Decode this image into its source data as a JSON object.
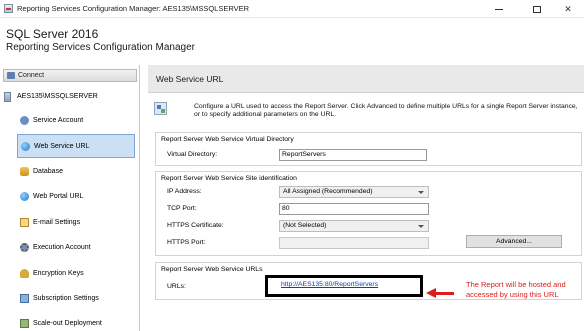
{
  "window": {
    "title": "Reporting Services Configuration Manager: AES135\\MSSQLSERVER"
  },
  "header": {
    "product": "SQL Server 2016",
    "subtitle": "Reporting Services Configuration Manager"
  },
  "sidebar": {
    "connect_label": "Connect",
    "server": "AES135\\MSSQLSERVER",
    "items": [
      {
        "label": "Service Account",
        "icon": "user-icon",
        "selected": false
      },
      {
        "label": "Web Service URL",
        "icon": "globe-icon",
        "selected": true
      },
      {
        "label": "Database",
        "icon": "database-icon",
        "selected": false
      },
      {
        "label": "Web Portal URL",
        "icon": "globe-icon",
        "selected": false
      },
      {
        "label": "E-mail Settings",
        "icon": "mail-icon",
        "selected": false
      },
      {
        "label": "Execution Account",
        "icon": "gear-icon",
        "selected": false
      },
      {
        "label": "Encryption Keys",
        "icon": "key-icon",
        "selected": false
      },
      {
        "label": "Subscription Settings",
        "icon": "subscription-icon",
        "selected": false
      },
      {
        "label": "Scale-out Deployment",
        "icon": "scale-out-icon",
        "selected": false
      }
    ]
  },
  "main": {
    "title": "Web Service URL",
    "intro": "Configure a URL used to access the Report Server.  Click Advanced to define multiple URLs for a single Report Server instance, or to specify additional parameters on the URL.",
    "virtual_directory": {
      "group_title": "Report Server Web Service Virtual Directory",
      "label": "Virtual Directory:",
      "value": "ReportServers"
    },
    "site_identification": {
      "group_title": "Report Server Web Service Site identification",
      "ip_label": "IP Address:",
      "ip_value": "All Assigned (Recommended)",
      "tcp_label": "TCP Port:",
      "tcp_value": "80",
      "https_cert_label": "HTTPS Certificate:",
      "https_cert_value": "(Not Selected)",
      "https_port_label": "HTTPS Port:",
      "https_port_value": "",
      "advanced_label": "Advanced..."
    },
    "urls": {
      "group_title": "Report Server Web Service URLs",
      "label": "URLs:",
      "link": "http://AES135:80/ReportServers"
    }
  },
  "annotation": {
    "note": "The Report will be hosted and accessed by using this URL",
    "color": "#e01b1b"
  }
}
